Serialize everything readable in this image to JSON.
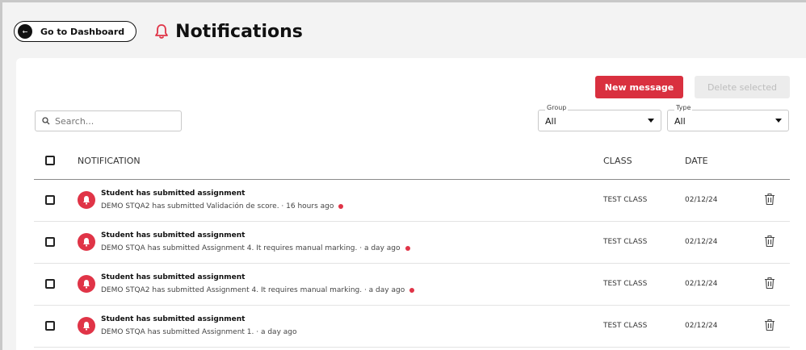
{
  "topbar": {
    "back_label": "Go to Dashboard",
    "back_icon": "arrow-left-icon",
    "title": "Notifications",
    "title_icon": "bell-icon"
  },
  "toolbar": {
    "new_message_label": "New message",
    "delete_selected_label": "Delete selected"
  },
  "search": {
    "placeholder": "Search..."
  },
  "filters": {
    "group": {
      "label": "Group",
      "value": "All"
    },
    "type": {
      "label": "Type",
      "value": "All"
    }
  },
  "table": {
    "headers": {
      "notification": "NOTIFICATION",
      "class": "CLASS",
      "date": "DATE"
    },
    "rows": [
      {
        "title": "Student has submitted assignment",
        "subtitle": "DEMO STQA2 has submitted Validación de score. · 16 hours ago",
        "unread": true,
        "class": "TEST CLASS",
        "date": "02/12/24"
      },
      {
        "title": "Student has submitted assignment",
        "subtitle": "DEMO STQA has submitted Assignment 4. It requires manual marking. · a day ago",
        "unread": true,
        "class": "TEST CLASS",
        "date": "02/12/24"
      },
      {
        "title": "Student has submitted assignment",
        "subtitle": "DEMO STQA2 has submitted Assignment 4. It requires manual marking. · a day ago",
        "unread": true,
        "class": "TEST CLASS",
        "date": "02/12/24"
      },
      {
        "title": "Student has submitted assignment",
        "subtitle": "DEMO STQA has submitted Assignment 1. · a day ago",
        "unread": false,
        "class": "TEST CLASS",
        "date": "02/12/24"
      }
    ]
  },
  "colors": {
    "accent": "#d9303f",
    "unread_dot": "#e03447"
  }
}
